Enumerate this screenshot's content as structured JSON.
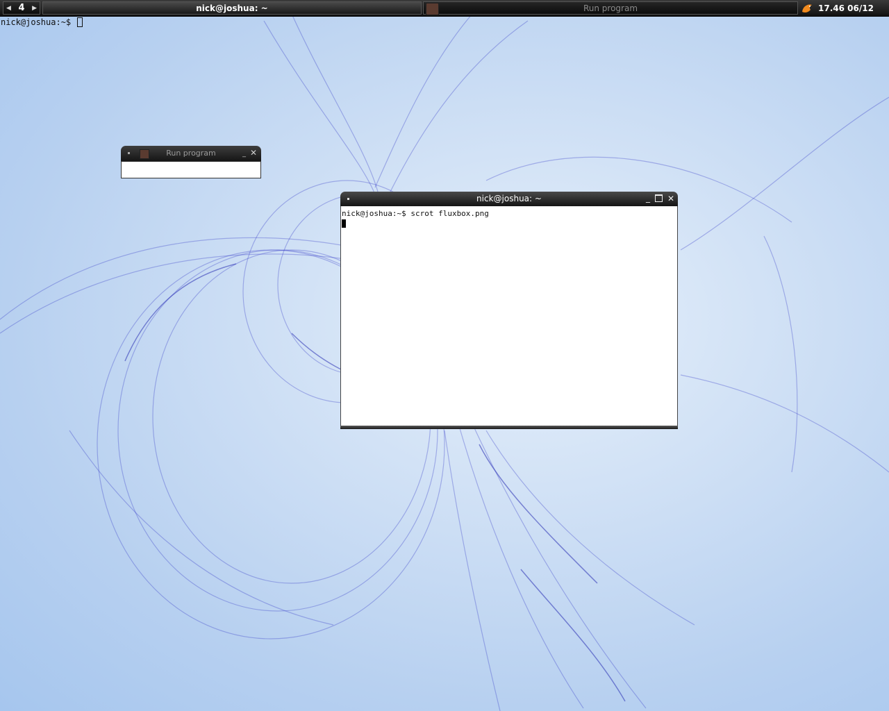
{
  "toolbar": {
    "workspace": {
      "prev": "◀",
      "number": "4",
      "next": "▶"
    },
    "tasks": [
      {
        "title": "nick@joshua: ~",
        "focused": true
      },
      {
        "title": "Run program",
        "focused": false
      }
    ],
    "clock": "17.46 06/12"
  },
  "desktop": {
    "prompt": "nick@joshua:~$"
  },
  "run_dialog": {
    "title": "Run program",
    "minimize": "_",
    "close": "✕",
    "input_value": ""
  },
  "terminal": {
    "title": "nick@joshua: ~",
    "minimize": "_",
    "close": "✕",
    "lines": [
      "nick@joshua:~$ scrot fluxbox.png"
    ]
  },
  "colors": {
    "wallpaper_light": "#e6f0fb",
    "wallpaper_blue": "#a6c6ee",
    "swirl": "#3a3fc8",
    "toolbar_dark": "#121212"
  }
}
